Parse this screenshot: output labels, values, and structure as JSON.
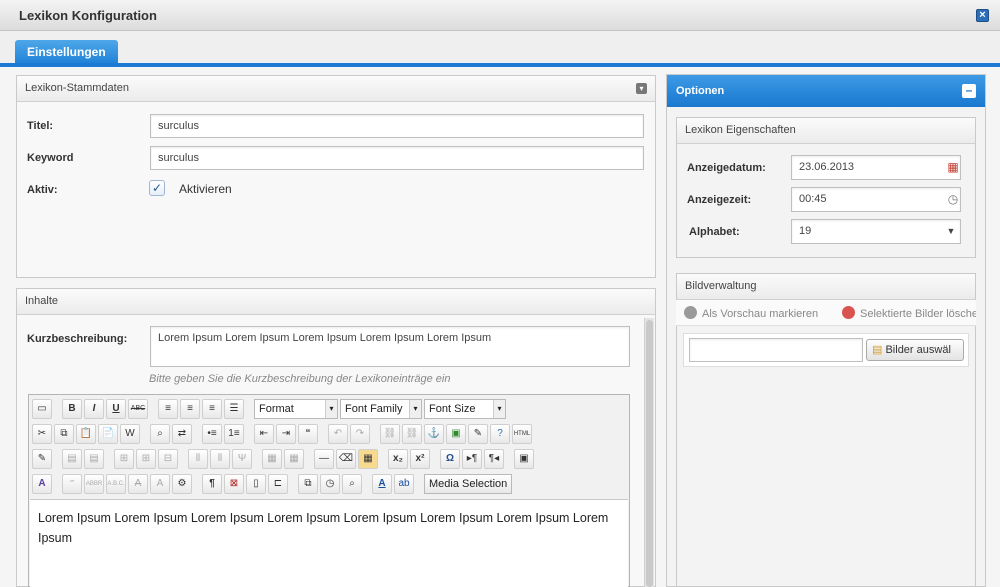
{
  "window": {
    "title": "Lexikon Konfiguration",
    "close_icon": "close-icon"
  },
  "tabs": [
    {
      "label": "Einstellungen"
    }
  ],
  "stammdaten": {
    "title": "Lexikon-Stammdaten",
    "titel_label": "Titel:",
    "titel_value": "surculus",
    "keyword_label": "Keyword",
    "keyword_value": "surculus",
    "aktiv_label": "Aktiv:",
    "aktivieren_label": "Aktivieren",
    "aktiv_checked": true
  },
  "inhalte": {
    "title": "Inhalte",
    "kurz_label": "Kurzbeschreibung:",
    "kurz_value": "Lorem Ipsum Lorem Ipsum Lorem Ipsum Lorem Ipsum Lorem Ipsum",
    "kurz_hint": "Bitte geben Sie die Kurzbeschreibung der Lexikoneinträge ein",
    "editor": {
      "format_select": "Format",
      "font_family_select": "Font Family",
      "font_size_select": "Font Size",
      "media_button": "Media Selection",
      "body_text": "Lorem Ipsum Lorem Ipsum Lorem Ipsum Lorem Ipsum Lorem Ipsum Lorem Ipsum Lorem Ipsum Lorem Ipsum"
    }
  },
  "optionen": {
    "title": "Optionen",
    "eigenschaften_title": "Lexikon Eigenschaften",
    "anzeigedatum_label": "Anzeigedatum:",
    "anzeigedatum_value": "23.06.2013",
    "anzeigezeit_label": "Anzeigezeit:",
    "anzeigezeit_value": "00:45",
    "alphabet_label": "Alphabet:",
    "alphabet_value": "19",
    "bildverwaltung_title": "Bildverwaltung",
    "vorschau_action": "Als Vorschau markieren",
    "loeschen_action": "Selektierte Bilder lösche",
    "bilder_button": "Bilder auswäl"
  },
  "colors": {
    "accent": "#1b7bd2",
    "tab": "#2b8ddc"
  }
}
